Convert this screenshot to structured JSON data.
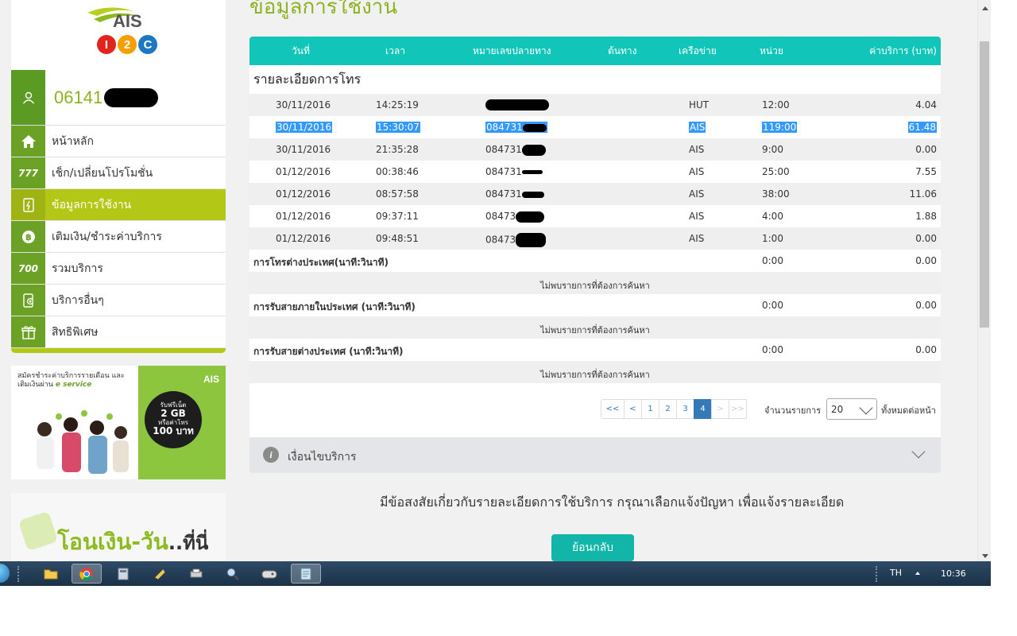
{
  "sidebar": {
    "logo_text": "AIS",
    "logo_badges": [
      "I",
      "2",
      "C"
    ],
    "phone_number": "06141",
    "menu": [
      {
        "label": "หน้าหลัก",
        "icon": "home-icon"
      },
      {
        "label": "เช็ก/เปลี่ยนโปรโมชั่น",
        "icon": "promo-icon"
      },
      {
        "label": "ข้อมูลการใช้งาน",
        "icon": "usage-icon",
        "active": true
      },
      {
        "label": "เติมเงิน/ชำระค่าบริการ",
        "icon": "baht-coin-icon"
      },
      {
        "label": "รวมบริการ",
        "icon": "services-icon"
      },
      {
        "label": "บริการอื่นๆ",
        "icon": "phone-plus-icon"
      },
      {
        "label": "สิทธิพิเศษ",
        "icon": "gift-icon"
      }
    ],
    "banner1": {
      "headline": "สมัครชำระค่าบริการรายเดือน และเติมเงินผ่าน",
      "brand": "AIS",
      "service": "e service",
      "badge_line1": "รับฟรีเน็ต",
      "badge_amount": "2 GB",
      "badge_or": "หรือค่าโทร",
      "badge_baht": "100 บาท"
    },
    "banner2": {
      "text_green": "โอนเงิน-วัน",
      "text_dark": "..ที่นี่"
    }
  },
  "main": {
    "title": "ข้อมูลการใช้งาน",
    "columns": [
      "วันที่",
      "เวลา",
      "หมายเลขปลายทาง",
      "ต้นทาง",
      "เครือข่าย",
      "หน่วย",
      "ค่าบริการ (บาท)"
    ],
    "section_title": "รายละเอียดการโทร",
    "rows": [
      {
        "date": "30/11/2016",
        "time": "14:25:19",
        "number": "",
        "network": "HUT",
        "unit": "12:00",
        "cost": "4.04"
      },
      {
        "date": "30/11/2016",
        "time": "15:30:07",
        "number": "084731",
        "network": "AIS",
        "unit": "119:00",
        "cost": "61.48",
        "selected": true
      },
      {
        "date": "30/11/2016",
        "time": "21:35:28",
        "number": "084731",
        "network": "AIS",
        "unit": "9:00",
        "cost": "0.00"
      },
      {
        "date": "01/12/2016",
        "time": "00:38:46",
        "number": "084731",
        "network": "AIS",
        "unit": "25:00",
        "cost": "7.55"
      },
      {
        "date": "01/12/2016",
        "time": "08:57:58",
        "number": "084731",
        "network": "AIS",
        "unit": "38:00",
        "cost": "11.06"
      },
      {
        "date": "01/12/2016",
        "time": "09:37:11",
        "number": "08473",
        "network": "AIS",
        "unit": "4:00",
        "cost": "1.88"
      },
      {
        "date": "01/12/2016",
        "time": "09:48:51",
        "number": "08473",
        "network": "AIS",
        "unit": "1:00",
        "cost": "0.00"
      }
    ],
    "summaries": [
      {
        "label": "การโทรต่างประเทศ(นาที:วินาที)",
        "unit": "0:00",
        "cost": "0.00",
        "empty": "ไม่พบรายการที่ต้องการค้นหา"
      },
      {
        "label": "การรับสายภายในประเทศ (นาที:วินาที)",
        "unit": "0:00",
        "cost": "0.00",
        "empty": "ไม่พบรายการที่ต้องการค้นหา"
      },
      {
        "label": "การรับสายต่างประเทศ (นาที:วินาที)",
        "unit": "0:00",
        "cost": "0.00",
        "empty": "ไม่พบรายการที่ต้องการค้นหา"
      }
    ],
    "pager": {
      "first": "<<",
      "prev": "<",
      "pages": [
        "1",
        "2",
        "3",
        "4"
      ],
      "active": "4",
      "next": ">",
      "last": ">>",
      "per_page_label": "จำนวนรายการ",
      "per_page_value": "20",
      "per_page_suffix": "ทั้งหมดต่อหน้า"
    },
    "accordion_label": "เงื่อนไขบริการ",
    "help_text": "มีข้อสงสัยเกี่ยวกับรายละเอียดการใช้บริการ กรุณาเลือกแจ้งปัญหา เพื่อแจ้งรายละเอียด",
    "back_button": "ย้อนกลับ"
  },
  "taskbar": {
    "language": "TH",
    "clock": "10:36"
  },
  "colors": {
    "header_teal": "#11c6b8",
    "sidebar_green": "#6ba226",
    "active_lime": "#b3c716",
    "selection_blue": "#3399ff",
    "button_teal": "#11b6a8"
  }
}
